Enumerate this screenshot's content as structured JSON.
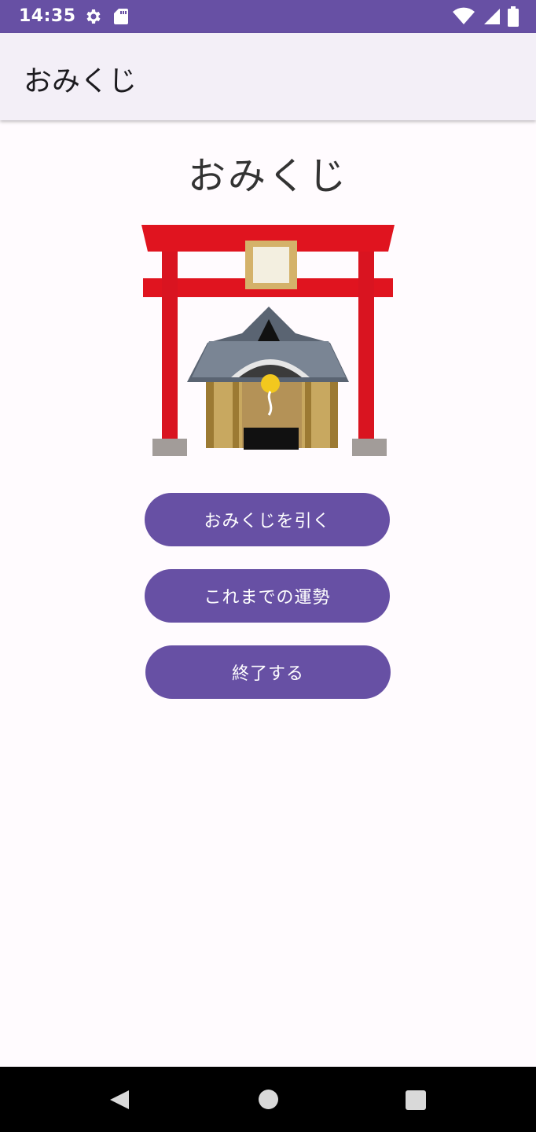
{
  "status_bar": {
    "time": "14:35",
    "icons": [
      "gear-icon",
      "sd-card-icon",
      "wifi-icon",
      "signal-icon",
      "battery-icon"
    ],
    "background": "#6750a4"
  },
  "app_bar": {
    "title": "おみくじ"
  },
  "main": {
    "heading": "おみくじ",
    "illustration": "shrine-torii-illustration",
    "buttons": {
      "draw": "おみくじを引く",
      "history": "これまでの運勢",
      "exit": "終了する"
    },
    "accent_color": "#6750a4"
  },
  "nav_bar": {
    "icons": [
      "back-icon",
      "home-icon",
      "recents-icon"
    ]
  }
}
